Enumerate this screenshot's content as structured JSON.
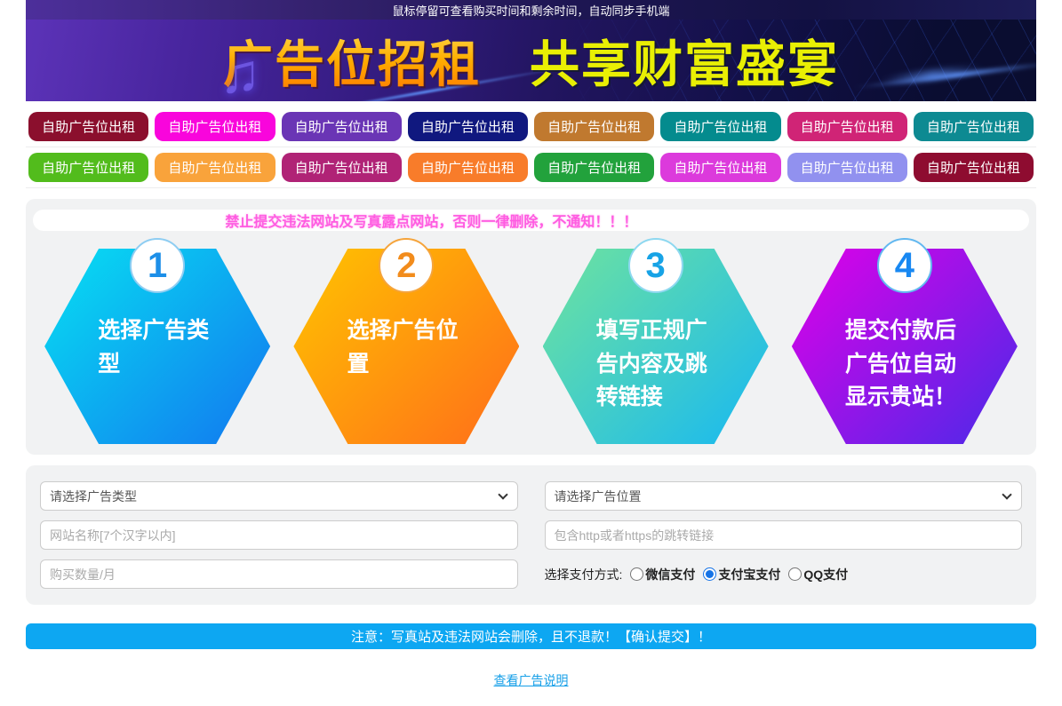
{
  "topbar": {
    "text": "鼠标停留可查看购买时间和剩余时间，自动同步手机端"
  },
  "banner": {
    "title": "广告位招租",
    "subtitle": "共享财富盛宴",
    "music_note_icon": "♫"
  },
  "ad_buttons": {
    "label": "自助广告位出租",
    "row1_colors": [
      "#8b0f2d",
      "#f905dc",
      "#6a35b5",
      "#10187f",
      "#c0792f",
      "#048b8e",
      "#d02476",
      "#0d8a92"
    ],
    "row2_colors": [
      "#52bc1c",
      "#f9a33b",
      "#b02376",
      "#f87c2a",
      "#22a23c",
      "#dc3adc",
      "#9191ef",
      "#8e0c30"
    ]
  },
  "notice": {
    "text": "禁止提交违法网站及写真露点网站，否则一律删除，不通知！！！",
    "color": "#ff5ce1"
  },
  "steps": [
    {
      "number": "1",
      "text": "选择广告类型",
      "gradient": [
        "#07e0f2",
        "#1277ef"
      ],
      "number_color": "#1d8fe8",
      "ring_color": "#8ecdf2"
    },
    {
      "number": "2",
      "text": "选择广告位置",
      "gradient": [
        "#ffc400",
        "#ff6d1a"
      ],
      "number_color": "#f28c1c",
      "ring_color": "#f5a43c"
    },
    {
      "number": "3",
      "text": "填写正规广告内容及跳转链接",
      "gradient": [
        "#6fe39e",
        "#17b8f2"
      ],
      "number_color": "#17a3e6",
      "ring_color": "#8ed8f0"
    },
    {
      "number": "4",
      "text": "提交付款后广告位自动显示贵站！",
      "gradient": [
        "#e000e8",
        "#4a2ae8"
      ],
      "number_color": "#1888f2",
      "ring_color": "#62b8f0"
    }
  ],
  "form": {
    "type_select_value": "请选择广告类型",
    "position_select_value": "请选择广告位置",
    "site_name_placeholder": "网站名称[7个汉字以内]",
    "link_placeholder": "包含http或者https的跳转链接",
    "quantity_placeholder": "购买数量/月",
    "payment": {
      "label": "选择支付方式:",
      "accent_color": "#1673e6",
      "options": [
        {
          "label": "微信支付",
          "checked": false
        },
        {
          "label": "支付宝支付",
          "checked": true
        },
        {
          "label": "QQ支付",
          "checked": false
        }
      ]
    }
  },
  "submit": {
    "text": "注意：写真站及违法网站会删除，且不退款！【确认提交】！",
    "color": "#0da7f2"
  },
  "footer_link": {
    "text": "查看广告说明",
    "color": "#18a0e8"
  }
}
